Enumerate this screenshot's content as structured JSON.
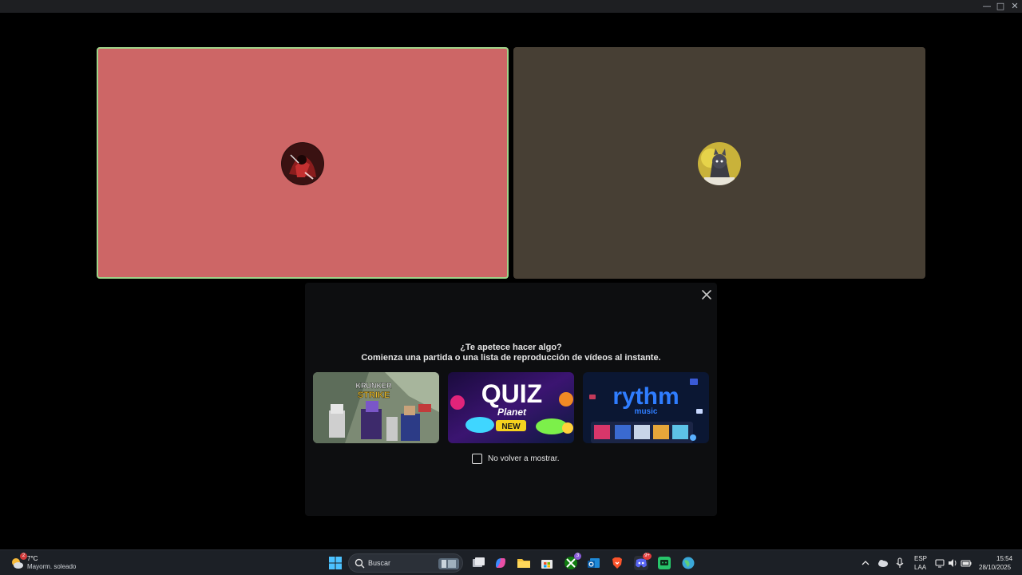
{
  "activity_panel": {
    "title": "¿Te apetece hacer algo?",
    "subtitle": "Comienza una partida o una lista de reproducción de vídeos al instante.",
    "cards": [
      {
        "name": "Krunker Strike",
        "logo": "KRUNKER",
        "logo2": "STRIKE"
      },
      {
        "name": "Quiz Planet",
        "logo": "QUIZ",
        "logo2": "Planet",
        "badge": "NEW"
      },
      {
        "name": "Rythm",
        "logo": "rythm",
        "logo2": "music"
      }
    ],
    "dont_show_label": "No volver a mostrar."
  },
  "taskbar": {
    "weather_temp": "7°C",
    "weather_condition": "Mayorm. soleado",
    "weather_badge": "2",
    "search_label": "Buscar",
    "xbox_badge": "3",
    "discord_badge": "9+",
    "language": "ESP",
    "layout": "LAA",
    "time": "15:54",
    "date": "28/10/2025"
  },
  "colors": {
    "tile_1": "#cd6666",
    "tile_2": "#473f34",
    "speaking_border": "#9fd48a"
  }
}
